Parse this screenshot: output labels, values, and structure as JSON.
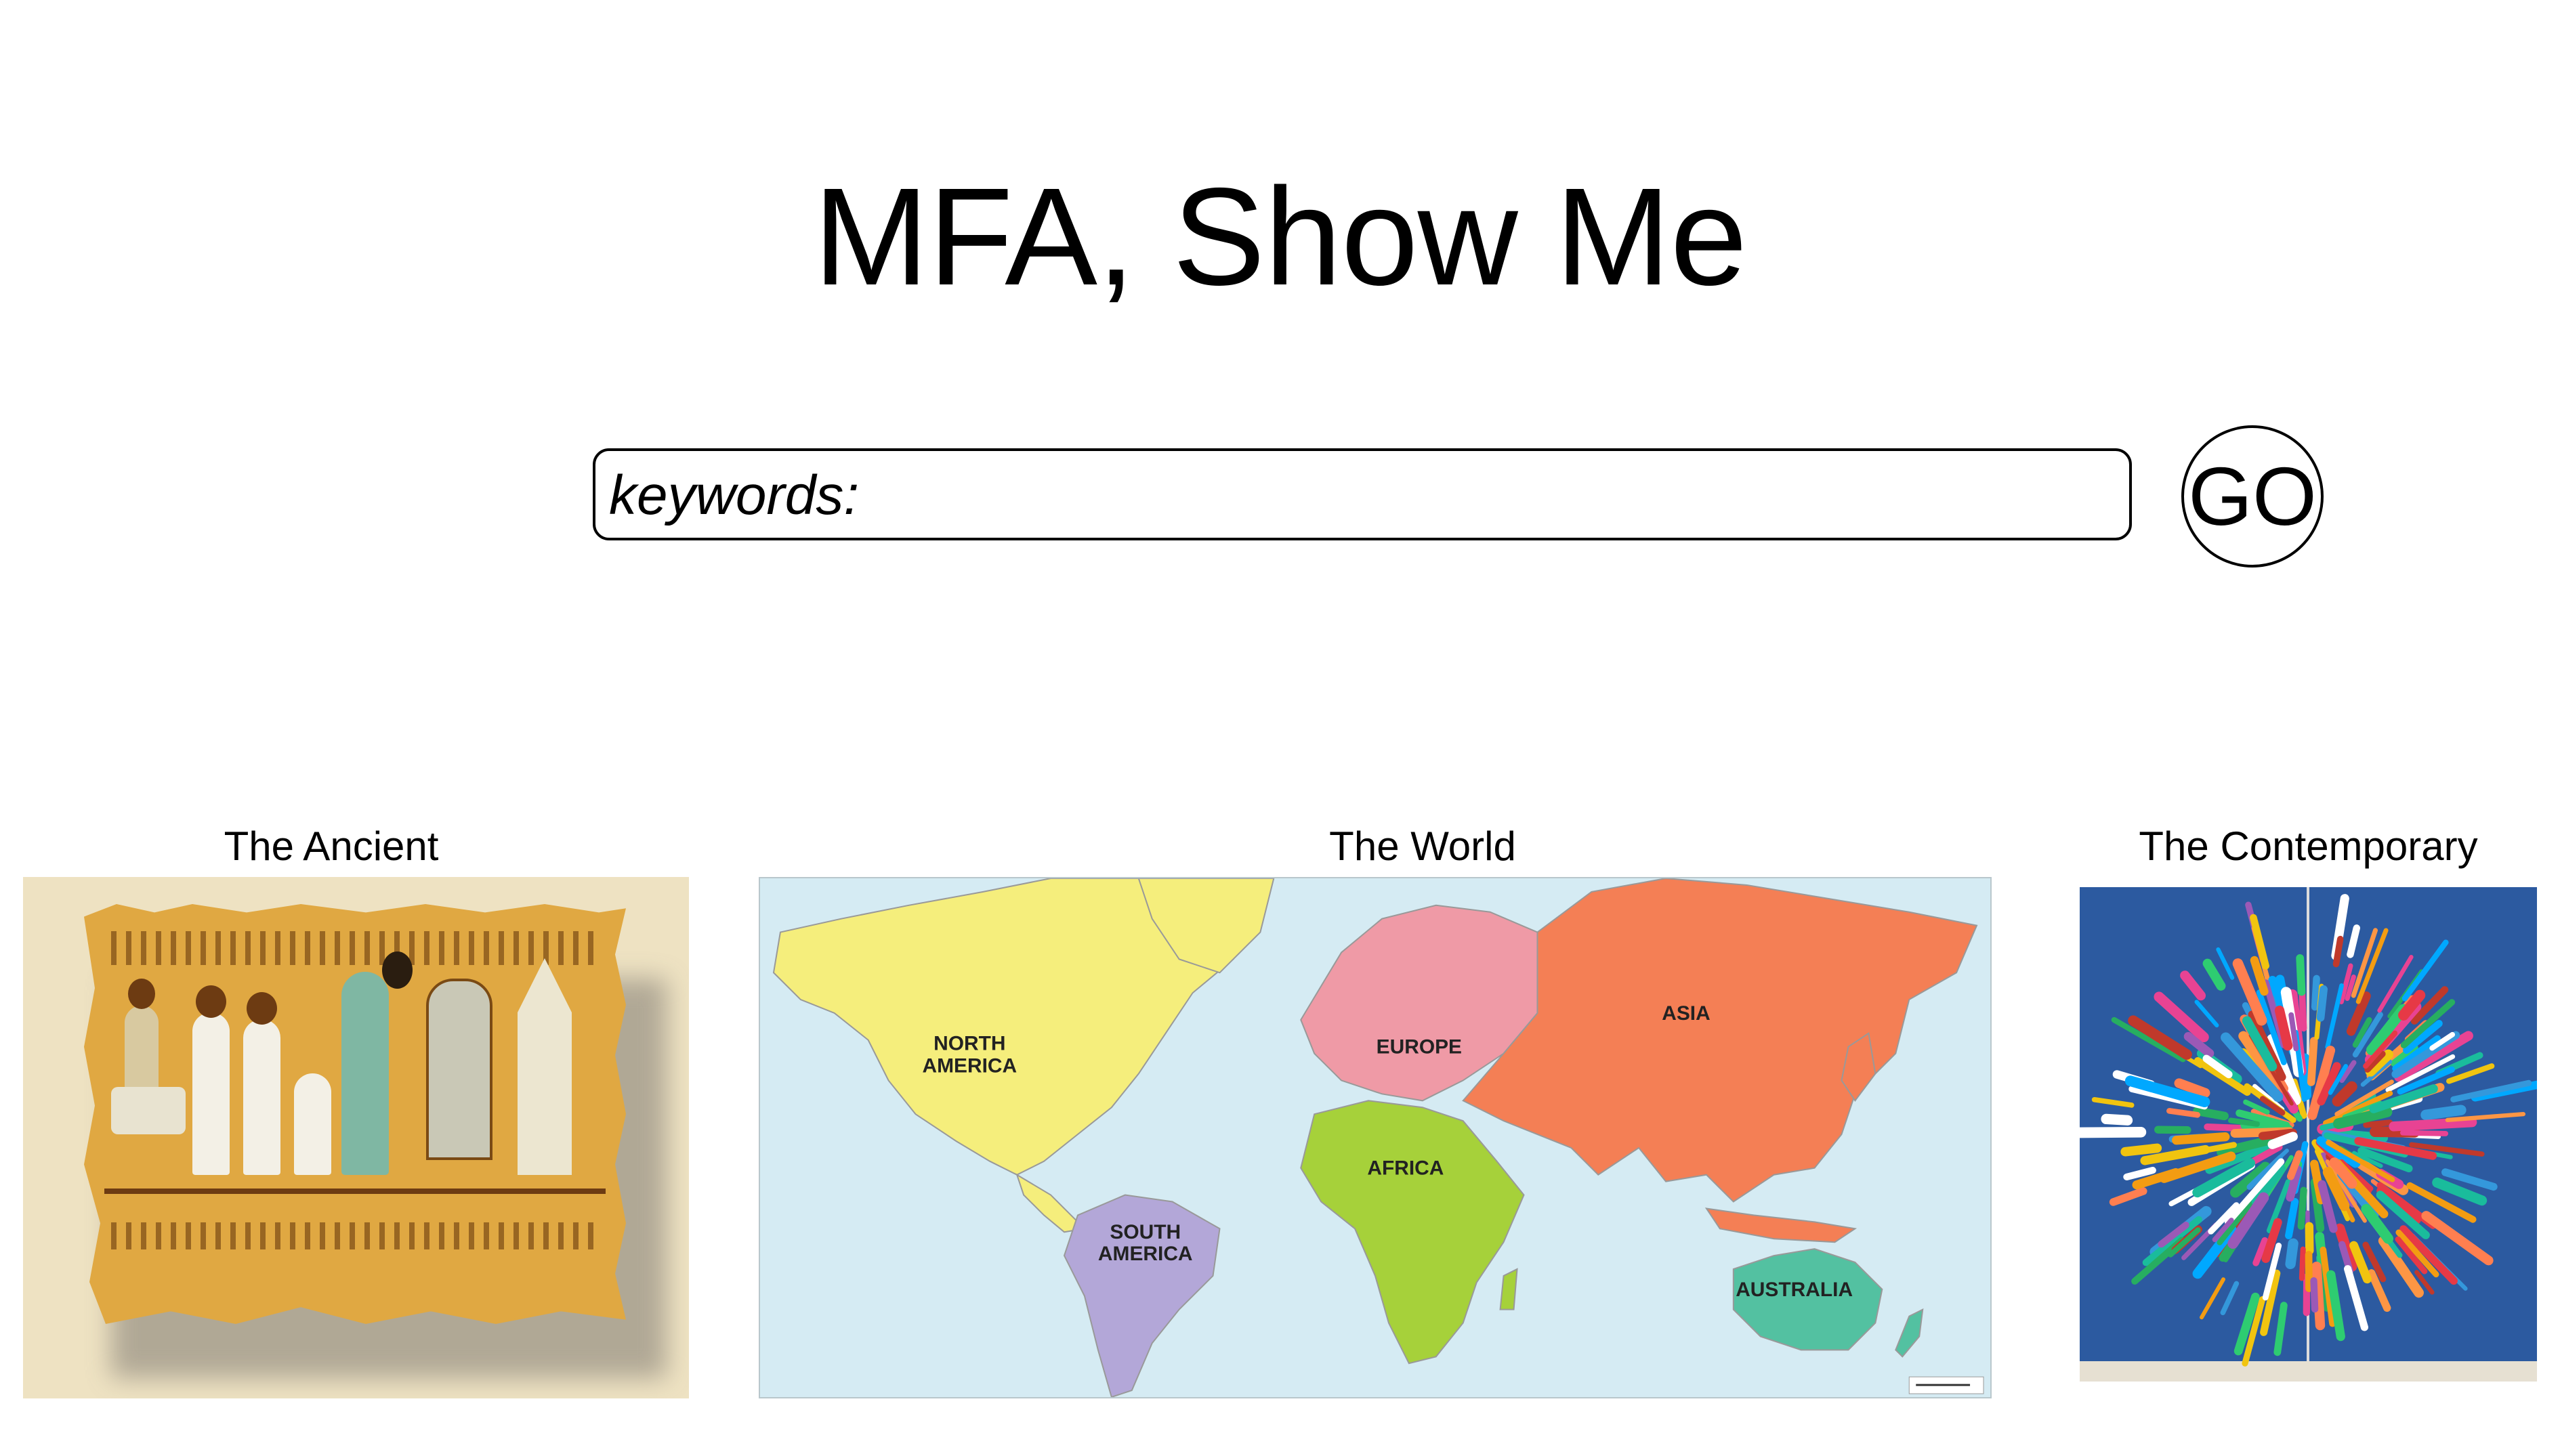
{
  "page": {
    "title": "MFA, Show Me"
  },
  "search": {
    "placeholder": "keywords:",
    "value": "",
    "go_label": "GO"
  },
  "categories": [
    {
      "label": "The Ancient",
      "image": "egyptian-papyrus-scene"
    },
    {
      "label": "The World",
      "image": "world-continents-map"
    },
    {
      "label": "The Contemporary",
      "image": "colorful-pencils-installation"
    }
  ],
  "world_map": {
    "continents": [
      {
        "name_line1": "NORTH",
        "name_line2": "AMERICA",
        "color": "#f5ee7c"
      },
      {
        "name_line1": "SOUTH",
        "name_line2": "AMERICA",
        "color": "#b3a7d8"
      },
      {
        "name_line1": "EUROPE",
        "name_line2": "",
        "color": "#ef9aa6"
      },
      {
        "name_line1": "AFRICA",
        "name_line2": "",
        "color": "#a6d13a"
      },
      {
        "name_line1": "ASIA",
        "name_line2": "",
        "color": "#f47f55"
      },
      {
        "name_line1": "AUSTRALIA",
        "name_line2": "",
        "color": "#53c1a1"
      }
    ],
    "ocean_color": "#d5ebf3"
  }
}
